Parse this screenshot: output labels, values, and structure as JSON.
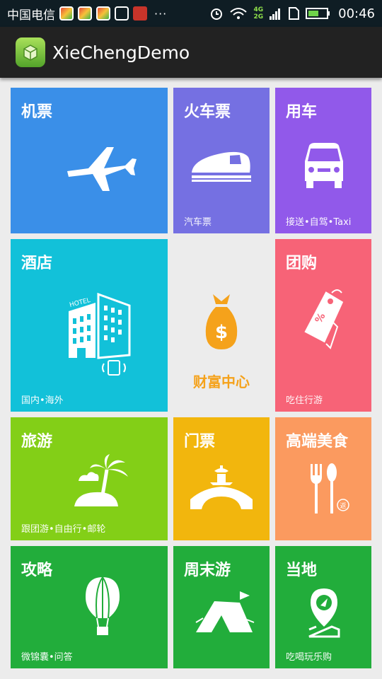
{
  "status_bar": {
    "carrier": "中国电信",
    "overflow": "···",
    "network_top": "4G",
    "network_bottom": "2G",
    "time": "00:46",
    "icons": [
      "app-icon",
      "app-icon",
      "app-icon",
      "image-icon",
      "cat-icon",
      "alarm-icon",
      "wifi-icon",
      "signal-icon",
      "sim-icon",
      "battery-icon"
    ]
  },
  "app_bar": {
    "title": "XieChengDemo",
    "logo_icon": "android-box-icon"
  },
  "tiles": {
    "flight": {
      "title": "机票",
      "icon": "airplane-icon",
      "color": "#3a8fe8"
    },
    "train": {
      "title": "火车票",
      "subtitle": "汽车票",
      "icon": "train-icon",
      "color": "#7570e2"
    },
    "car": {
      "title": "用车",
      "subtitle": "接送•自驾•Taxi",
      "icon": "car-icon",
      "color": "#9159ea"
    },
    "hotel": {
      "title": "酒店",
      "subtitle": "国内•海外",
      "icon": "hotel-icon",
      "color": "#12c1d9"
    },
    "wealth": {
      "title": "财富中心",
      "icon": "money-bag-icon",
      "color": "#f5a21b"
    },
    "groupbuy": {
      "title": "团购",
      "subtitle": "吃住行游",
      "icon": "tag-icon",
      "color": "#f76377"
    },
    "travel": {
      "title": "旅游",
      "subtitle": "跟团游•自由行•邮轮",
      "icon": "palm-island-icon",
      "color": "#83cf17"
    },
    "tickets": {
      "title": "门票",
      "icon": "pavilion-bridge-icon",
      "color": "#f2b60d"
    },
    "food": {
      "title": "高端美食",
      "icon": "fork-spoon-icon",
      "color": "#fb9a5f"
    },
    "guide": {
      "title": "攻略",
      "subtitle": "微锦囊•问答",
      "icon": "hot-air-balloon-icon",
      "color": "#22ad3b"
    },
    "weekend": {
      "title": "周末游",
      "icon": "tent-icon",
      "color": "#22ad3b"
    },
    "local": {
      "title": "当地",
      "subtitle": "吃喝玩乐购",
      "icon": "map-pin-icon",
      "color": "#22ad3b"
    }
  }
}
